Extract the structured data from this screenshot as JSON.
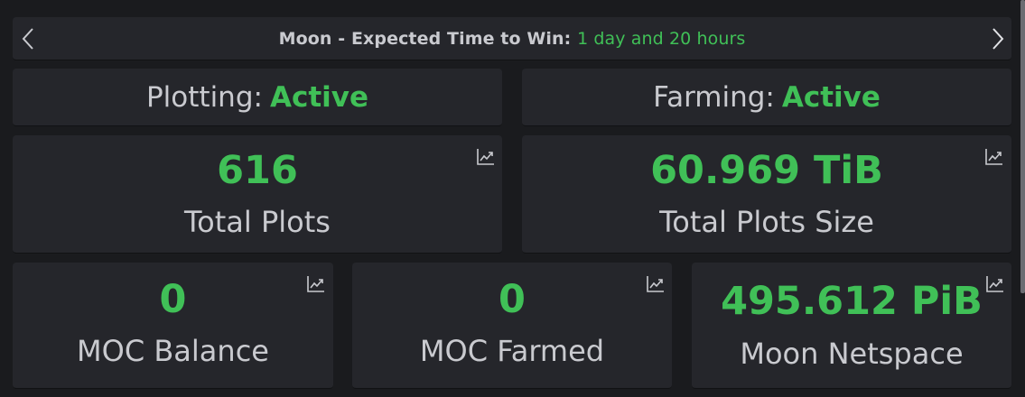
{
  "banner": {
    "prefix": "Moon - Expected Time to Win: ",
    "value": "1 day and 20 hours"
  },
  "plotting": {
    "label": "Plotting:",
    "status": "Active"
  },
  "farming": {
    "label": "Farming:",
    "status": "Active"
  },
  "cards": {
    "total_plots": {
      "value": "616",
      "label": "Total Plots"
    },
    "total_plots_size": {
      "value": "60.969 TiB",
      "label": "Total Plots Size"
    },
    "moc_balance": {
      "value": "0",
      "label": "MOC Balance"
    },
    "moc_farmed": {
      "value": "0",
      "label": "MOC Farmed"
    },
    "moon_netspace": {
      "value": "495.612 PiB",
      "label": "Moon Netspace"
    }
  },
  "icons": {
    "prev": "chevron-left-icon",
    "next": "chevron-right-icon",
    "chart": "chart-line-icon"
  },
  "colors": {
    "accent_green": "#40c057",
    "card_bg": "#25262b",
    "page_bg": "#1a1b1e",
    "text": "#c9cacf"
  }
}
